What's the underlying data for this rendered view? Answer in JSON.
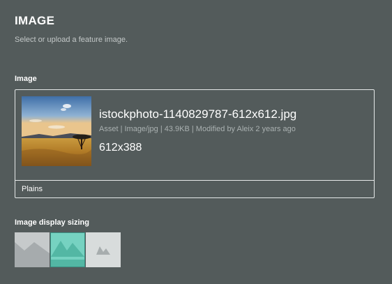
{
  "section": {
    "title": "IMAGE",
    "description": "Select or upload a feature image."
  },
  "image_field": {
    "label": "Image",
    "asset": {
      "filename": "istockphoto-1140829787-612x612.jpg",
      "meta": "Asset | Image/jpg | 43.9KB | Modified by Aleix 2 years ago",
      "dimensions": "612x388",
      "caption": "Plains",
      "thumbnail_icon": "savanna-landscape-photo"
    }
  },
  "sizing_field": {
    "label": "Image display sizing",
    "options": [
      {
        "name": "fill",
        "icon": "image-fill-icon",
        "selected": false
      },
      {
        "name": "fit",
        "icon": "image-fit-icon",
        "selected": true
      },
      {
        "name": "original",
        "icon": "image-original-icon",
        "selected": false
      }
    ]
  },
  "colors": {
    "background": "#535b5b",
    "selected_accent": "#76d2c1"
  }
}
